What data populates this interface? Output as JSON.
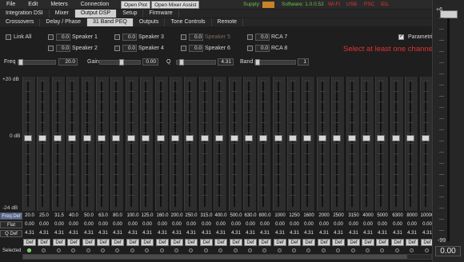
{
  "menu": {
    "items": [
      "File",
      "Edit",
      "Meters",
      "Connection"
    ],
    "open_plot": "Open Plot",
    "open_mixer_assist": "Open Mixer Assist"
  },
  "status": {
    "supply_label": "Supply:",
    "software": "Software: 1.0.0.52",
    "wifi": "Wi-Fi",
    "usb": "USB",
    "psc": "PSC",
    "idl": "IDL",
    "supply_color": "#c8822a",
    "indicator_color": "#e23232",
    "software_color": "#6ac24a"
  },
  "tabs_row1": [
    "Integration DSI",
    "Mixer",
    "Output DSP",
    "Setup",
    "Firmware"
  ],
  "tabs_row1_active": "Output DSP",
  "tabs_row2": [
    "Crossovers",
    "Delay / Phase",
    "31 Band PEQ",
    "Outputs",
    "Tone Controls",
    "Remote"
  ],
  "tabs_row2_active": "31 Band PEQ",
  "channels": {
    "link_all": "Link All",
    "parametric": "Parametric",
    "items": [
      {
        "gain": "0.0",
        "name": "Speaker 1",
        "muted": false
      },
      {
        "gain": "0.0",
        "name": "Speaker 2",
        "muted": false
      },
      {
        "gain": "0.0",
        "name": "Speaker 3",
        "muted": false
      },
      {
        "gain": "0.0",
        "name": "Speaker 4",
        "muted": false
      },
      {
        "gain": "0.0",
        "name": "Speaker 5",
        "muted": true
      },
      {
        "gain": "0.0",
        "name": "Speaker 6",
        "muted": false
      },
      {
        "gain": "0.0",
        "name": "RCA 7",
        "muted": false
      },
      {
        "gain": "0.0",
        "name": "RCA 8",
        "muted": false
      }
    ]
  },
  "warning": "Select at least one channel",
  "params": {
    "freq_label": "Freq",
    "freq_value": "20.0",
    "gain_label": "Gain",
    "gain_value": "0.00",
    "q_label": "Q",
    "q_value": "4.31",
    "band_label": "Band",
    "band_value": "1"
  },
  "eq": {
    "axis_top": "+20 dB",
    "axis_mid": "0 dB",
    "axis_bottom": "-24 dB",
    "row_freq": "Freq Def",
    "row_flat": "Flat",
    "row_q": "Q Def",
    "row_selected": "Selected",
    "def_label": "Def",
    "range_max": 20,
    "range_min": -24,
    "bands": [
      {
        "freq": "20.0",
        "gain": 0,
        "q": "4.31"
      },
      {
        "freq": "25.0",
        "gain": 0,
        "q": "4.31"
      },
      {
        "freq": "31.5",
        "gain": 0,
        "q": "4.31"
      },
      {
        "freq": "40.0",
        "gain": 0,
        "q": "4.31"
      },
      {
        "freq": "50.0",
        "gain": 0,
        "q": "4.31"
      },
      {
        "freq": "63.0",
        "gain": 0,
        "q": "4.31"
      },
      {
        "freq": "80.0",
        "gain": 0,
        "q": "4.31"
      },
      {
        "freq": "100.0",
        "gain": 0,
        "q": "4.31"
      },
      {
        "freq": "125.0",
        "gain": 0,
        "q": "4.31"
      },
      {
        "freq": "160.0",
        "gain": 0,
        "q": "4.31"
      },
      {
        "freq": "200.0",
        "gain": 0,
        "q": "4.31"
      },
      {
        "freq": "250.0",
        "gain": 0,
        "q": "4.31"
      },
      {
        "freq": "315.0",
        "gain": 0,
        "q": "4.31"
      },
      {
        "freq": "400.0",
        "gain": 0,
        "q": "4.31"
      },
      {
        "freq": "500.0",
        "gain": 0,
        "q": "4.31"
      },
      {
        "freq": "630.0",
        "gain": 0,
        "q": "4.31"
      },
      {
        "freq": "800.0",
        "gain": 0,
        "q": "4.31"
      },
      {
        "freq": "1000",
        "gain": 0,
        "q": "4.31"
      },
      {
        "freq": "1250",
        "gain": 0,
        "q": "4.31"
      },
      {
        "freq": "1600",
        "gain": 0,
        "q": "4.31"
      },
      {
        "freq": "2000",
        "gain": 0,
        "q": "4.31"
      },
      {
        "freq": "2500",
        "gain": 0,
        "q": "4.31"
      },
      {
        "freq": "3150",
        "gain": 0,
        "q": "4.31"
      },
      {
        "freq": "4000",
        "gain": 0,
        "q": "4.31"
      },
      {
        "freq": "5000",
        "gain": 0,
        "q": "4.31"
      },
      {
        "freq": "6300",
        "gain": 0,
        "q": "4.31"
      },
      {
        "freq": "8000",
        "gain": 0,
        "q": "4.31"
      },
      {
        "freq": "10000",
        "gain": 0,
        "q": "4.31"
      }
    ],
    "flat_value": "0.00",
    "selected_band": 1
  },
  "master": {
    "top_label": "+6",
    "bottom_label": "-99",
    "value": "0.00",
    "level_db": 6
  }
}
